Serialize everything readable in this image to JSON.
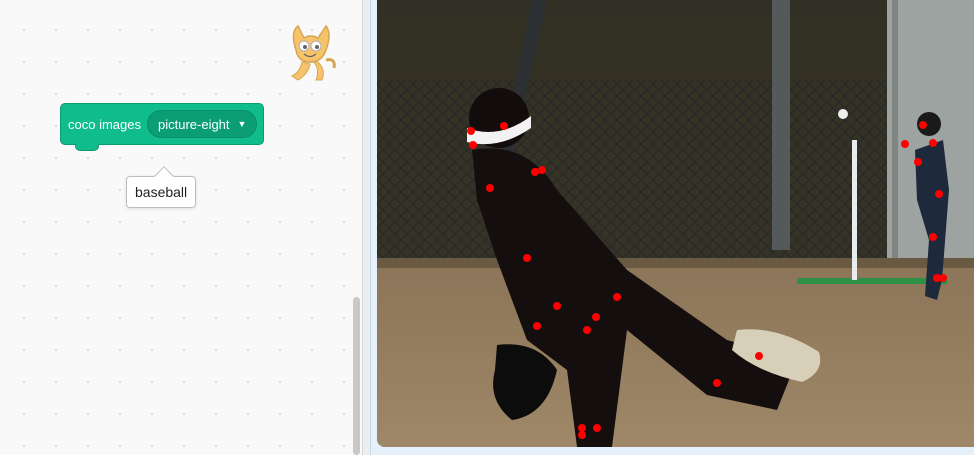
{
  "block": {
    "label": "coco images",
    "menu_value": "picture-eight"
  },
  "report": {
    "value": "baseball"
  },
  "stage": {
    "scene": "baseball-pitch-photo",
    "keypoint_color": "#ff0000"
  },
  "colors": {
    "block_green": "#0fbd8c",
    "workspace_bg": "#f9f9f9",
    "stage_border": "#e6f0fa"
  },
  "icons": {
    "mascot": "scratch-cat-icon",
    "dropdown": "chevron-down-icon"
  }
}
